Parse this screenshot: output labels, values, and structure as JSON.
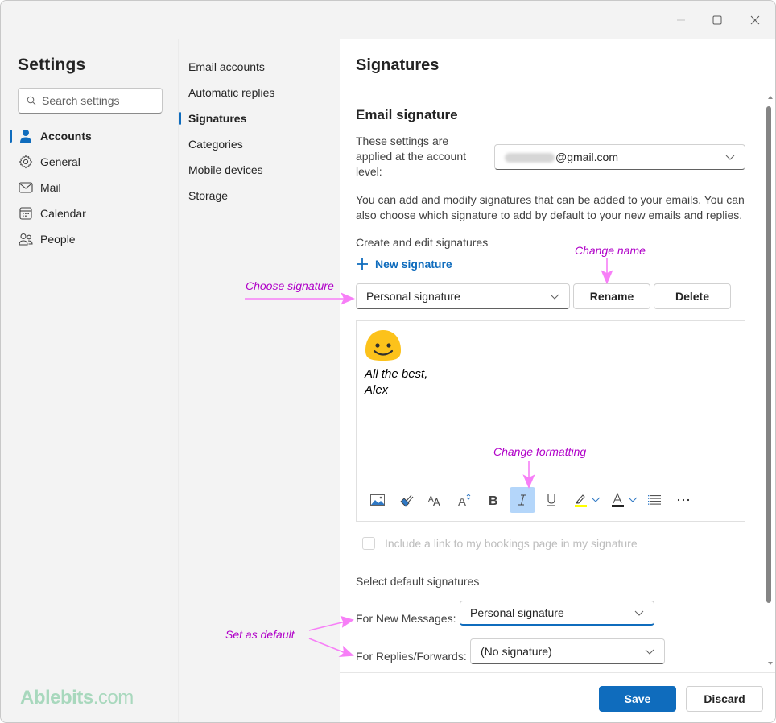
{
  "window": {
    "controls": {
      "minimize": "minimize",
      "maximize": "maximize",
      "close": "close"
    }
  },
  "sidebar": {
    "title": "Settings",
    "search_placeholder": "Search settings",
    "items": [
      {
        "label": "Accounts",
        "icon": "person-icon",
        "active": true
      },
      {
        "label": "General",
        "icon": "gear-icon",
        "active": false
      },
      {
        "label": "Mail",
        "icon": "mail-icon",
        "active": false
      },
      {
        "label": "Calendar",
        "icon": "calendar-icon",
        "active": false
      },
      {
        "label": "People",
        "icon": "people-icon",
        "active": false
      }
    ]
  },
  "subnav": {
    "items": [
      {
        "label": "Email accounts",
        "active": false
      },
      {
        "label": "Automatic replies",
        "active": false
      },
      {
        "label": "Signatures",
        "active": true
      },
      {
        "label": "Categories",
        "active": false
      },
      {
        "label": "Mobile devices",
        "active": false
      },
      {
        "label": "Storage",
        "active": false
      }
    ]
  },
  "main": {
    "title": "Signatures",
    "section_title": "Email signature",
    "account_label": "These settings are applied at the account level:",
    "account_value_visible": "@gmail.com",
    "description": "You can add and modify signatures that can be added to your emails. You can also choose which signature to add by default to your new emails and replies.",
    "create_label": "Create and edit signatures",
    "new_signature_label": "New signature",
    "signature_select": "Personal signature",
    "rename_label": "Rename",
    "delete_label": "Delete",
    "editor": {
      "emoji": "smiling-face",
      "lines": [
        "All the best,",
        "Alex"
      ]
    },
    "toolbar": [
      {
        "name": "insert-picture",
        "icon": "picture-icon"
      },
      {
        "name": "format-painter",
        "icon": "paintbrush-icon"
      },
      {
        "name": "font-size",
        "icon": "font-size-icon"
      },
      {
        "name": "change-case",
        "icon": "change-case-icon"
      },
      {
        "name": "bold",
        "icon": "bold-icon",
        "label": "B"
      },
      {
        "name": "italic",
        "icon": "italic-icon",
        "label": "I",
        "active": true
      },
      {
        "name": "underline",
        "icon": "underline-icon",
        "label": "U"
      },
      {
        "name": "highlight",
        "icon": "highlighter-icon",
        "color": "#ffff00"
      },
      {
        "name": "font-color",
        "icon": "font-color-icon",
        "label": "A",
        "color": "#242424"
      },
      {
        "name": "bullets",
        "icon": "bullet-list-icon"
      },
      {
        "name": "more",
        "icon": "more-icon",
        "label": "···"
      }
    ],
    "bookings_checkbox": {
      "label": "Include a link to my bookings page in my signature",
      "checked": false,
      "disabled": true
    },
    "defaults_label": "Select default signatures",
    "new_messages_label": "For New Messages:",
    "new_messages_value": "Personal signature",
    "replies_label": "For Replies/Forwards:",
    "replies_value": "(No signature)",
    "save_label": "Save",
    "discard_label": "Discard"
  },
  "annotations": {
    "choose_signature": "Choose signature",
    "change_name": "Change name",
    "change_formatting": "Change formatting",
    "set_as_default": "Set as default",
    "color": "#b000c8",
    "arrow_color": "#f77ff7"
  },
  "watermark": {
    "brand": "Ablebits",
    "suffix": ".com"
  },
  "colors": {
    "accent": "#0f6cbd",
    "italic_active_bg": "#b4d6fa"
  }
}
